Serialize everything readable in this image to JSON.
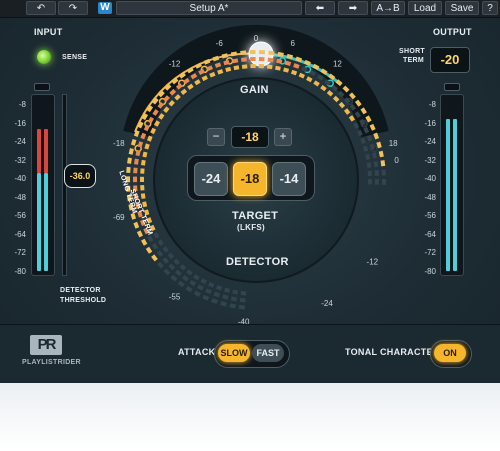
{
  "toolbar": {
    "undo_icon": "undo-icon",
    "redo_icon": "redo-icon",
    "logo": "W",
    "preset_name": "Setup A*",
    "prev_icon": "arrow-left-icon",
    "next_icon": "arrow-right-icon",
    "ab_label": "A→B",
    "load_label": "Load",
    "save_label": "Save",
    "help_label": "?"
  },
  "input": {
    "title": "INPUT",
    "sense_label": "SENSE",
    "sense_on": true,
    "scale": [
      "-8",
      "-16",
      "-24",
      "-32",
      "-40",
      "-48",
      "-56",
      "-64",
      "-72",
      "-80"
    ],
    "threshold_value": "-36.0",
    "threshold_label_1": "DETECTOR",
    "threshold_label_2": "THRESHOLD",
    "left_level": -35,
    "right_level": -35
  },
  "gain": {
    "title": "GAIN",
    "scale_labels": [
      "-18",
      "-12",
      "-6",
      "0",
      "6",
      "12",
      "18"
    ],
    "value_db": 0
  },
  "target": {
    "minus_label": "−",
    "plus_label": "+",
    "value": "-18",
    "presets": [
      "-24",
      "-18",
      "-14"
    ],
    "selected": "-18",
    "label_1": "TARGET",
    "label_2": "(LKFS)"
  },
  "detector": {
    "title": "DETECTOR",
    "short_term_label": "SHORT TERM",
    "long_term_label": "LONG TERM",
    "scale_labels": [
      "0",
      "-12",
      "-24",
      "-40",
      "-55",
      "-69"
    ]
  },
  "output": {
    "title": "OUTPUT",
    "short_term_label_1": "SHORT",
    "short_term_label_2": "TERM",
    "value": "-20",
    "scale": [
      "-8",
      "-16",
      "-24",
      "-32",
      "-40",
      "-48",
      "-56",
      "-64",
      "-72",
      "-80"
    ],
    "left_level": -22,
    "right_level": -22
  },
  "bottom": {
    "logo_mark": "PR",
    "product_name": "PLAYLISTRIDER",
    "attack_label": "ATTACK",
    "attack_options": [
      "SLOW",
      "FAST"
    ],
    "attack_selected": "SLOW",
    "tonal_label": "TONAL CHARACTER",
    "tonal_value": "ON"
  },
  "colors": {
    "accent": "#f5b52d",
    "meter_cyan": "#4fd0d8",
    "meter_red": "#d9463d",
    "gain_teal": "#3bc3c3",
    "gain_amber": "#f0b84a",
    "led_green": "#8fe04a"
  }
}
